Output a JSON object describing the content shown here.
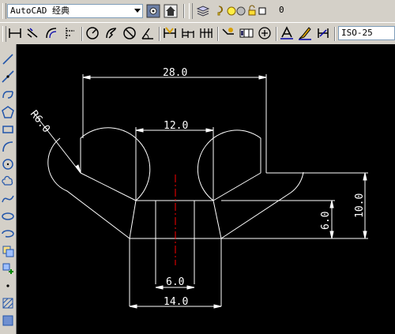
{
  "toolbar_top": {
    "workspace_value": "AutoCAD 经典",
    "layer_value": "0"
  },
  "toolbar_dim": {
    "dimstyle_value": "ISO-25"
  },
  "drawing": {
    "dim_28": "28.0",
    "dim_12": "12.0",
    "dim_radius": "R6.0",
    "dim_6_vertical": "6.0",
    "dim_10_vertical": "10.0",
    "dim_6_horizontal": "6.0",
    "dim_14": "14.0"
  },
  "colors": {
    "canvas_bg": "#000000",
    "geometry": "#ffffff",
    "centerline": "#ff0000"
  }
}
